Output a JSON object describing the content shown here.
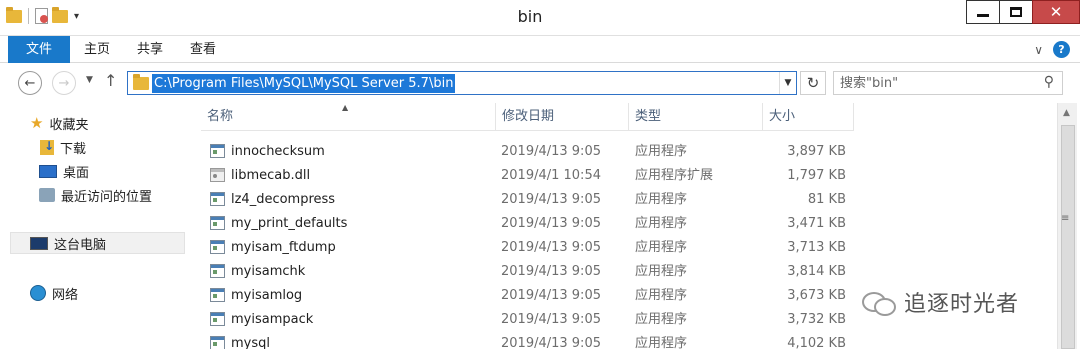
{
  "window": {
    "title": "bin"
  },
  "ribbon": {
    "tabs": [
      "文件",
      "主页",
      "共享",
      "查看"
    ]
  },
  "address": {
    "path": "C:\\Program Files\\MySQL\\MySQL Server 5.7\\bin"
  },
  "search": {
    "placeholder": "搜索\"bin\""
  },
  "sidebar": {
    "favorites": "收藏夹",
    "downloads": "下载",
    "desktop": "桌面",
    "recent": "最近访问的位置",
    "this_pc": "这台电脑",
    "network": "网络"
  },
  "columns": {
    "name": "名称",
    "date": "修改日期",
    "type": "类型",
    "size": "大小"
  },
  "files": [
    {
      "name": "innochecksum",
      "date": "2019/4/13 9:05",
      "type": "应用程序",
      "size": "3,897 KB"
    },
    {
      "name": "libmecab.dll",
      "date": "2019/4/1 10:54",
      "type": "应用程序扩展",
      "size": "1,797 KB"
    },
    {
      "name": "lz4_decompress",
      "date": "2019/4/13 9:05",
      "type": "应用程序",
      "size": "81 KB"
    },
    {
      "name": "my_print_defaults",
      "date": "2019/4/13 9:05",
      "type": "应用程序",
      "size": "3,471 KB"
    },
    {
      "name": "myisam_ftdump",
      "date": "2019/4/13 9:05",
      "type": "应用程序",
      "size": "3,713 KB"
    },
    {
      "name": "myisamchk",
      "date": "2019/4/13 9:05",
      "type": "应用程序",
      "size": "3,814 KB"
    },
    {
      "name": "myisamlog",
      "date": "2019/4/13 9:05",
      "type": "应用程序",
      "size": "3,673 KB"
    },
    {
      "name": "myisampack",
      "date": "2019/4/13 9:05",
      "type": "应用程序",
      "size": "3,732 KB"
    },
    {
      "name": "mysql",
      "date": "2019/4/13 9:05",
      "type": "应用程序",
      "size": "4,102 KB"
    }
  ],
  "watermark": {
    "text": "追逐时光者"
  }
}
